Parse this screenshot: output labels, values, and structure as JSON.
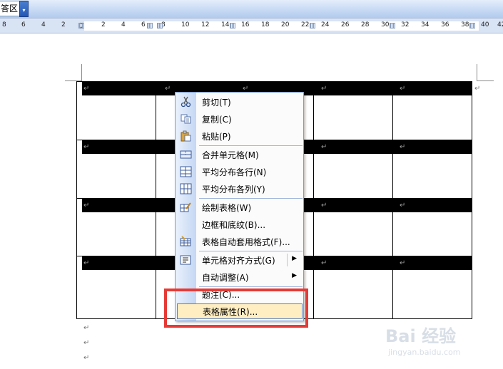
{
  "toolbar": {
    "style_box_text": "答区",
    "dropdown_glyph": "▾"
  },
  "ruler": {
    "ticks": [
      "8",
      "6",
      "4",
      "2",
      "2",
      "4",
      "6",
      "8",
      "10",
      "12",
      "14",
      "16",
      "18",
      "20",
      "22",
      "24",
      "26",
      "28",
      "30",
      "32",
      "34",
      "36",
      "38",
      "40",
      "42"
    ]
  },
  "document": {
    "paragraph_mark": "↵"
  },
  "context_menu": {
    "items": [
      {
        "label": "剪切(T)",
        "icon": "scissors-icon"
      },
      {
        "label": "复制(C)",
        "icon": "copy-icon"
      },
      {
        "label": "粘贴(P)",
        "icon": "paste-icon"
      },
      {
        "label": "合并单元格(M)",
        "icon": "merge-cells-icon"
      },
      {
        "label": "平均分布各行(N)",
        "icon": "distribute-rows-icon"
      },
      {
        "label": "平均分布各列(Y)",
        "icon": "distribute-columns-icon"
      },
      {
        "label": "绘制表格(W)",
        "icon": "draw-table-icon"
      },
      {
        "label": "边框和底纹(B)...",
        "icon": ""
      },
      {
        "label": "表格自动套用格式(F)...",
        "icon": "table-autoformat-icon"
      },
      {
        "label": "单元格对齐方式(G)",
        "icon": "cell-alignment-icon",
        "submenu": true
      },
      {
        "label": "自动调整(A)",
        "icon": "",
        "submenu": true
      },
      {
        "label": "题注(C)...",
        "icon": ""
      },
      {
        "label": "表格属性(R)...",
        "icon": "",
        "selected": true
      }
    ],
    "submenu_arrow": "▶"
  },
  "watermark": {
    "logo_text": "Bai 经验",
    "url_text": "jingyan.baidu.com"
  },
  "colors": {
    "highlight_box": "#e53a36",
    "menu_selected_bg": "#ffeec2",
    "menu_border": "#7a9cd3"
  }
}
